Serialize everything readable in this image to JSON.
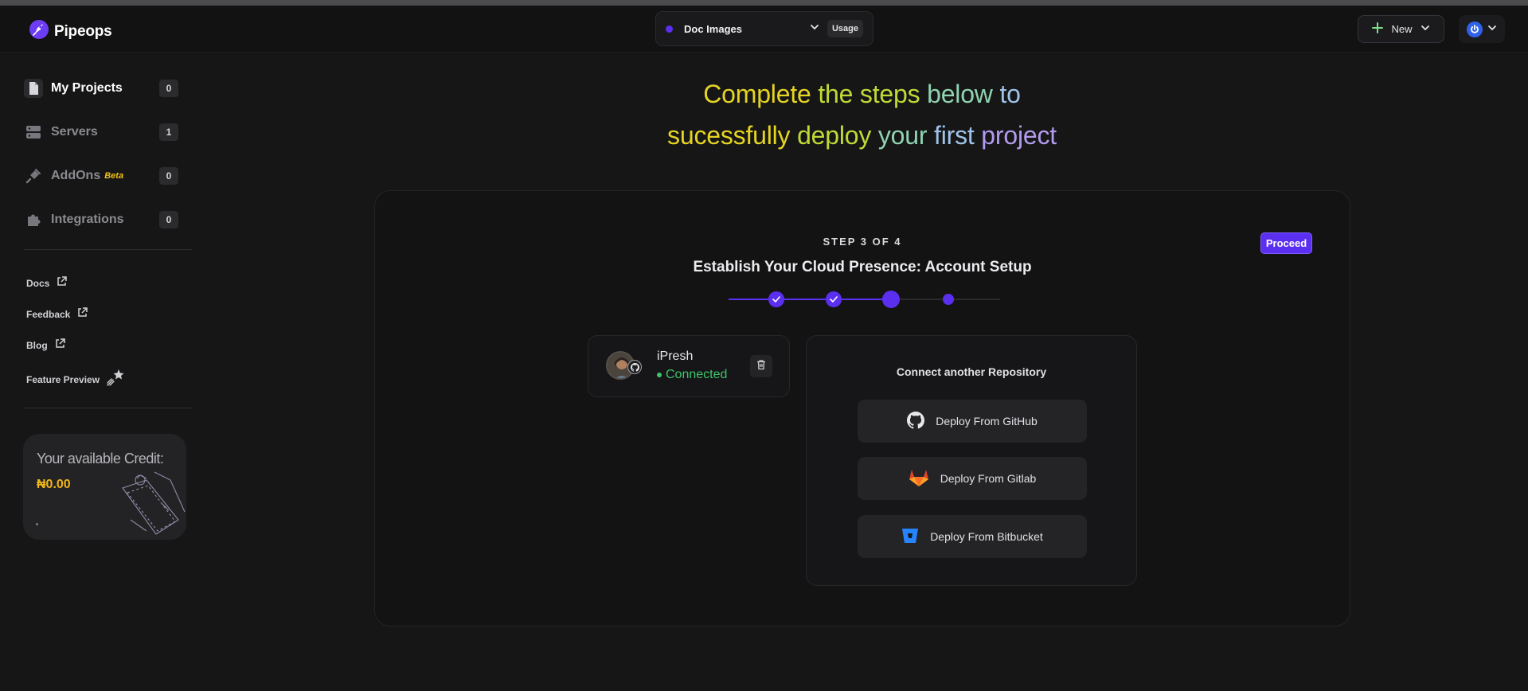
{
  "header": {
    "brand": "Pipeops",
    "project": "Doc Images",
    "usage_label": "Usage",
    "new_label": "New"
  },
  "sidebar": {
    "items": [
      {
        "label": "My Projects",
        "count": "0"
      },
      {
        "label": "Servers",
        "count": "1"
      },
      {
        "label": "AddOns",
        "badge": "Beta",
        "count": "0"
      },
      {
        "label": "Integrations",
        "count": "0"
      }
    ],
    "links": [
      {
        "label": "Docs"
      },
      {
        "label": "Feedback"
      },
      {
        "label": "Blog"
      },
      {
        "label": "Feature Preview"
      }
    ],
    "credit": {
      "title": "Your available Credit:",
      "value": "₦0.00"
    }
  },
  "headline": {
    "line1": [
      "Complete",
      "the",
      "steps",
      "below",
      "to"
    ],
    "line2": [
      "sucessfully",
      "deploy",
      "your",
      "first",
      "project"
    ]
  },
  "setup": {
    "step_label": "STEP 3 OF 4",
    "title": "Establish Your Cloud Presence: Account Setup",
    "proceed_label": "Proceed",
    "progress": {
      "current": 3,
      "total": 4
    },
    "account": {
      "name": "iPresh",
      "status": "Connected"
    },
    "repo": {
      "title": "Connect another Repository",
      "buttons": [
        {
          "label": "Deploy From GitHub",
          "icon": "github-icon"
        },
        {
          "label": "Deploy From Gitlab",
          "icon": "gitlab-icon"
        },
        {
          "label": "Deploy From Bitbucket",
          "icon": "bitbucket-icon"
        }
      ]
    }
  },
  "colors": {
    "accent": "#5b2ff0",
    "success": "#3ec46b",
    "credit": "#f0b417"
  }
}
